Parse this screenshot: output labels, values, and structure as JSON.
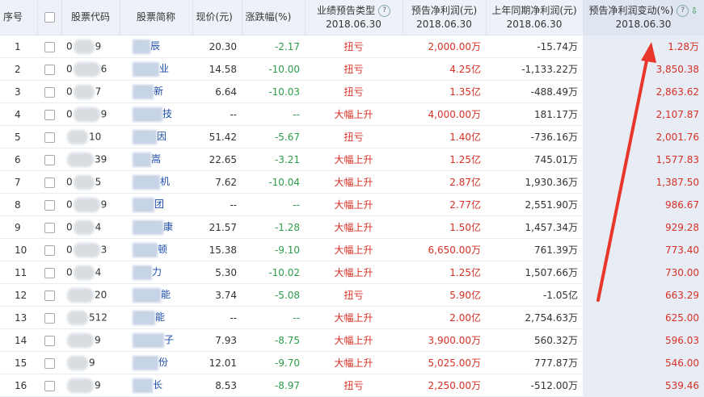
{
  "header": {
    "col_seq": "序号",
    "col_code": "股票代码",
    "col_name": "股票简称",
    "col_price": "现价(元)",
    "col_change": "涨跌幅(%)",
    "col_type_line1": "业绩预告类型",
    "col_type_line2": "2018.06.30",
    "col_forecast_line1": "预告净利润(元)",
    "col_forecast_line2": "2018.06.30",
    "col_lastyear_line1": "上年同期净利润(元)",
    "col_lastyear_line2": "2018.06.30",
    "col_change_pct_line1": "预告净利润变动(%)",
    "col_change_pct_line2": "2018.06.30",
    "help_glyph": "?",
    "sort_glyph": "⇩"
  },
  "rows": [
    {
      "seq": "1",
      "code_start": "0",
      "code_end": "9",
      "name_end": "辰",
      "price": "20.30",
      "change": "-2.17",
      "type": "扭亏",
      "forecast": "2,000.00万",
      "lastyear": "-15.74万",
      "pct": "1.28万"
    },
    {
      "seq": "2",
      "code_start": "0",
      "code_end": "6",
      "name_end": "业",
      "price": "14.58",
      "change": "-10.00",
      "type": "扭亏",
      "forecast": "4.25亿",
      "lastyear": "-1,133.22万",
      "pct": "3,850.38"
    },
    {
      "seq": "3",
      "code_start": "0",
      "code_end": "7",
      "name_end": "新",
      "price": "6.64",
      "change": "-10.03",
      "type": "扭亏",
      "forecast": "1.35亿",
      "lastyear": "-488.49万",
      "pct": "2,863.62"
    },
    {
      "seq": "4",
      "code_start": "0",
      "code_end": "9",
      "name_end": "技",
      "price": "--",
      "change": "--",
      "type": "大幅上升",
      "forecast": "4,000.00万",
      "lastyear": "181.17万",
      "pct": "2,107.87"
    },
    {
      "seq": "5",
      "code_start": "",
      "code_end": "10",
      "name_end": "因",
      "price": "51.42",
      "change": "-5.67",
      "type": "扭亏",
      "forecast": "1.40亿",
      "lastyear": "-736.16万",
      "pct": "2,001.76"
    },
    {
      "seq": "6",
      "code_start": "",
      "code_end": "39",
      "name_end": "嵩",
      "price": "22.65",
      "change": "-3.21",
      "type": "大幅上升",
      "forecast": "1.25亿",
      "lastyear": "745.01万",
      "pct": "1,577.83"
    },
    {
      "seq": "7",
      "code_start": "0",
      "code_end": "5",
      "name_end": "机",
      "price": "7.62",
      "change": "-10.04",
      "type": "大幅上升",
      "forecast": "2.87亿",
      "lastyear": "1,930.36万",
      "pct": "1,387.50"
    },
    {
      "seq": "8",
      "code_start": "0",
      "code_end": "9",
      "name_end": "团",
      "price": "--",
      "change": "--",
      "type": "大幅上升",
      "forecast": "2.77亿",
      "lastyear": "2,551.90万",
      "pct": "986.67"
    },
    {
      "seq": "9",
      "code_start": "0",
      "code_end": "4",
      "name_end": "康",
      "price": "21.57",
      "change": "-1.28",
      "type": "大幅上升",
      "forecast": "1.50亿",
      "lastyear": "1,457.34万",
      "pct": "929.28"
    },
    {
      "seq": "10",
      "code_start": "0",
      "code_end": "3",
      "name_end": "顿",
      "price": "15.38",
      "change": "-9.10",
      "type": "大幅上升",
      "forecast": "6,650.00万",
      "lastyear": "761.39万",
      "pct": "773.40"
    },
    {
      "seq": "11",
      "code_start": "0",
      "code_end": "4",
      "name_end": "力",
      "price": "5.30",
      "change": "-10.02",
      "type": "大幅上升",
      "forecast": "1.25亿",
      "lastyear": "1,507.66万",
      "pct": "730.00"
    },
    {
      "seq": "12",
      "code_start": "",
      "code_end": "20",
      "name_end": "能",
      "price": "3.74",
      "change": "-5.08",
      "type": "扭亏",
      "forecast": "5.90亿",
      "lastyear": "-1.05亿",
      "pct": "663.29"
    },
    {
      "seq": "13",
      "code_start": "",
      "code_end": "512",
      "name_end": "能",
      "price": "--",
      "change": "--",
      "type": "大幅上升",
      "forecast": "2.00亿",
      "lastyear": "2,754.63万",
      "pct": "625.00"
    },
    {
      "seq": "14",
      "code_start": "",
      "code_end": "9",
      "name_end": "子",
      "price": "7.93",
      "change": "-8.75",
      "type": "大幅上升",
      "forecast": "3,900.00万",
      "lastyear": "560.32万",
      "pct": "596.03"
    },
    {
      "seq": "15",
      "code_start": "",
      "code_end": "9",
      "name_end": "份",
      "price": "12.01",
      "change": "-9.70",
      "type": "大幅上升",
      "forecast": "5,025.00万",
      "lastyear": "777.87万",
      "pct": "546.00"
    },
    {
      "seq": "16",
      "code_start": "",
      "code_end": "9",
      "name_end": "长",
      "price": "8.53",
      "change": "-8.97",
      "type": "扭亏",
      "forecast": "2,250.00万",
      "lastyear": "-512.00万",
      "pct": "539.46"
    }
  ],
  "colors": {
    "header_bg": "#eef2f8",
    "sorted_col_bg": "#e7ecf5",
    "negative_green": "#2e9d4a",
    "forecast_red": "#d93025",
    "link_blue": "#1a4aa8",
    "annotation_arrow": "#e8362a"
  }
}
